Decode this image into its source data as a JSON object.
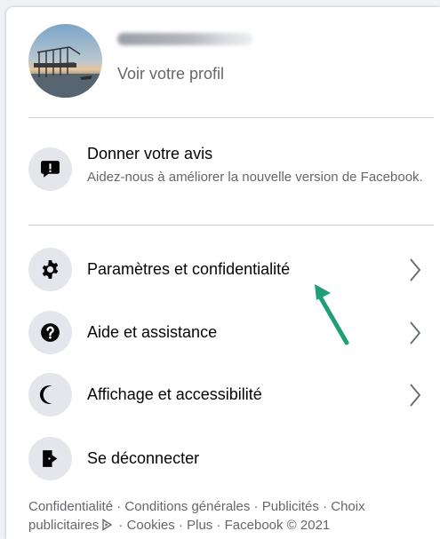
{
  "profile": {
    "subtitle": "Voir votre profil"
  },
  "feedback": {
    "title": "Donner votre avis",
    "subtitle": "Aidez-nous à améliorer la nouvelle version de Facebook."
  },
  "menu": [
    {
      "label": "Paramètres et confidentialité",
      "icon": "gear-icon",
      "has_chevron": true
    },
    {
      "label": "Aide et assistance",
      "icon": "help-icon",
      "has_chevron": true
    },
    {
      "label": "Affichage et accessibilité",
      "icon": "moon-icon",
      "has_chevron": true
    },
    {
      "label": "Se déconnecter",
      "icon": "logout-icon",
      "has_chevron": false
    }
  ],
  "footer": {
    "privacy": "Confidentialité",
    "terms": "Conditions générales",
    "ads": "Publicités",
    "ad_choices": "Choix publicitaires",
    "cookies": "Cookies",
    "more": "Plus",
    "copyright": "Facebook © 2021",
    "separator": " · "
  },
  "colors": {
    "text_primary": "#050505",
    "text_secondary": "#65676b",
    "icon_bg": "#e4e6eb",
    "divider": "#ced0d4",
    "annotation_arrow": "#1f9e78"
  }
}
